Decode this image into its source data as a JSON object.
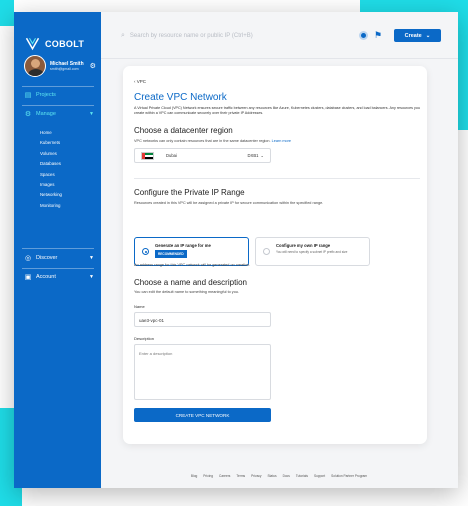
{
  "brand": {
    "name": "COBOLT"
  },
  "user": {
    "name": "Michael Smith",
    "email": "smith@gmail.com"
  },
  "sidebar": {
    "projects": "Projects",
    "manage": "Manage",
    "manage_items": [
      "Home",
      "Kubernets",
      "Volumes",
      "Databases",
      "Spaces",
      "Images",
      "Networking",
      "Monitoring"
    ],
    "discover": "Discover",
    "account": "Account"
  },
  "topbar": {
    "search_placeholder": "Search by resource name or public IP (Ctrl+B)",
    "create_label": "Create"
  },
  "page": {
    "back_label": "VPC",
    "title": "Create VPC Network",
    "description": "A Virtual Private Cloud (VPC) Network ensures secure traffic between any resources like Azure, Kubernetes clusters, database clusters, and load balancers. Any resources you create within a VPC can communicate securely over their private IP Addresses.",
    "region_heading": "Choose a datacenter region",
    "region_note": "VPC networks can only contain resources that are in the same datacenter region.",
    "region_link": "Learn more",
    "region_name": "Dubai",
    "region_code": "DXB1",
    "ip_heading": "Configure the Private IP Range",
    "ip_note": "Resources created in this VPC will be assigned a private IP for secure communication within the specified range.",
    "option1_title": "Generate an IP range for me",
    "option1_badge": "RECOMMENDED",
    "option2_title": "Configure my own IP range",
    "option2_desc": "You will need to specify a subnet IP prefix and size",
    "ip_footnote": "An address range for this VPC network will be generated on creation.",
    "name_heading": "Choose a name and description",
    "name_note": "You can edit the default name to something meaningful to you.",
    "name_label": "Name",
    "name_value": "uae3-vpc-01",
    "desc_label": "Description",
    "desc_placeholder": "Enter a description",
    "submit_label": "CREATE VPC NETWORK"
  },
  "footer": [
    "Blog",
    "Pricing",
    "Careers",
    "Terms",
    "Privacy",
    "Status",
    "Docs",
    "Tutorials",
    "Support",
    "Solution Partner Program"
  ],
  "colors": {
    "primary": "#0b69c7",
    "accent": "#1fdde8"
  }
}
